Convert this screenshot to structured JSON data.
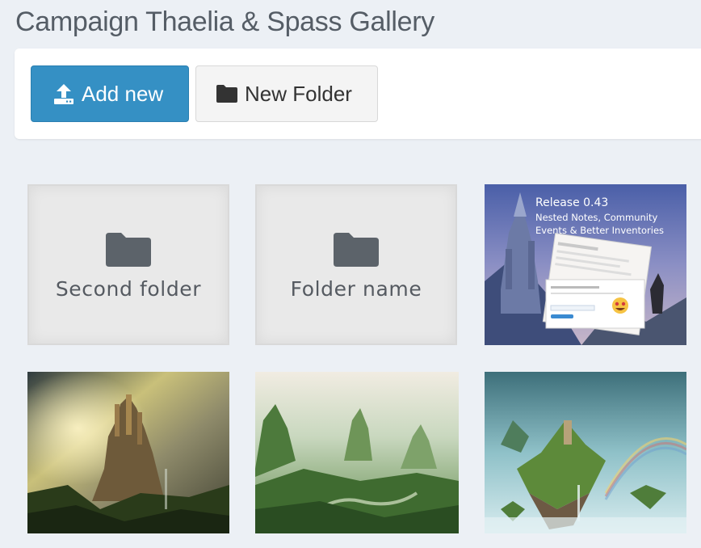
{
  "page": {
    "title": "Campaign Thaelia & Spass Gallery"
  },
  "toolbar": {
    "add_new_label": "Add new",
    "new_folder_label": "New Folder",
    "add_new_icon": "upload-icon",
    "new_folder_icon": "folder-icon"
  },
  "colors": {
    "background": "#ecf0f5",
    "primary_button": "#3590c4",
    "folder_icon": "#5c636a"
  },
  "gallery": {
    "folders": [
      {
        "name": "Second folder",
        "icon": "folder-icon"
      },
      {
        "name": "Folder name",
        "icon": "folder-icon"
      }
    ],
    "images": [
      {
        "kind": "release-banner",
        "title": "Release 0.43",
        "subtitle": "Nested Notes, Community Events & Better Inventories"
      },
      {
        "kind": "fantasy-castle-artwork"
      },
      {
        "kind": "green-valley-artwork"
      },
      {
        "kind": "floating-island-artwork"
      }
    ]
  }
}
